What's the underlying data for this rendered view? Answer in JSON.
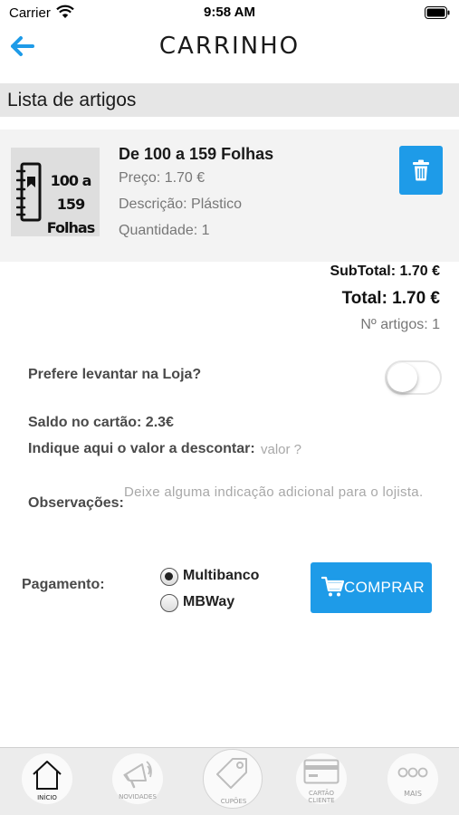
{
  "status_bar": {
    "carrier": "Carrier",
    "time": "9:58 AM"
  },
  "header": {
    "title": "CARRINHO"
  },
  "section": {
    "title": "Lista de artigos"
  },
  "cart_items": [
    {
      "thumb_line1": "100 a 159",
      "thumb_line2": "Folhas",
      "name": "De 100 a 159 Folhas",
      "price": "Preço: 1.70 €",
      "description": "Descrição: Plástico",
      "quantity": "Quantidade: 1"
    }
  ],
  "totals": {
    "subtotal": "SubTotal: 1.70 €",
    "total": "Total: 1.70 €",
    "count": "Nº artigos: 1"
  },
  "options": {
    "pickup_label": "Prefere levantar na Loja?",
    "pickup_enabled": false,
    "balance": "Saldo no cartão: 2.3€",
    "discount_label": "Indique aqui o valor a descontar:",
    "discount_placeholder": "valor ?",
    "discount_value": "",
    "observations_label": "Observações:",
    "observations_placeholder": "Deixe alguma indicação adicional para o lojista.",
    "observations_value": ""
  },
  "payment": {
    "label": "Pagamento:",
    "methods": [
      "Multibanco",
      "MBWay"
    ],
    "selected": "Multibanco",
    "buy_label": "COMPRAR"
  },
  "tabbar": {
    "items": [
      {
        "label": "INÍCIO",
        "icon": "home-icon",
        "active": true
      },
      {
        "label": "NOVIDADES",
        "icon": "megaphone-icon",
        "active": false
      },
      {
        "label": "CUPÕES",
        "icon": "tag-icon",
        "active": false
      },
      {
        "label": "CARTÃO CLIENTE",
        "icon": "card-icon",
        "active": false
      },
      {
        "label": "MAIS",
        "icon": "more-icon",
        "active": false
      }
    ]
  },
  "colors": {
    "accent": "#1e9be8",
    "section_bg": "#e6e6e6",
    "item_bg": "#f3f3f3",
    "muted_text": "#777777",
    "placeholder": "#a8a8a8",
    "tabbar_bg": "#ececec"
  }
}
